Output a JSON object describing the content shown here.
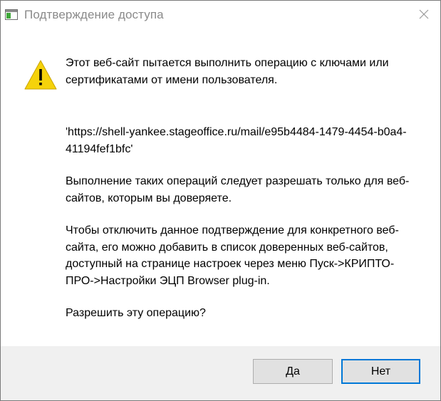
{
  "window": {
    "title": "Подтверждение доступа"
  },
  "message": {
    "intro": "Этот веб-сайт пытается выполнить операцию с ключами или сертификатами от имени пользователя.",
    "url": "'https://shell-yankee.stageoffice.ru/mail/e95b4484-1479-4454-b0a4-41194fef1bfc'",
    "warning": "Выполнение таких операций следует разрешать только для веб-сайтов, которым вы доверяете.",
    "howto": "Чтобы отключить данное подтверждение для конкретного веб-сайта, его можно добавить в список доверенных веб-сайтов, доступный на странице настроек через меню Пуск->КРИПТО-ПРО->Настройки ЭЦП Browser plug-in.",
    "question": "Разрешить эту операцию?"
  },
  "buttons": {
    "yes_label": "Да",
    "no_label": "Нет"
  },
  "icons": {
    "app": "window-app-icon",
    "close": "close-icon",
    "warning": "warning-icon"
  },
  "colors": {
    "warning_fill": "#f5d20b",
    "focus_border": "#0078d7",
    "footer_bg": "#f0f0f0"
  }
}
